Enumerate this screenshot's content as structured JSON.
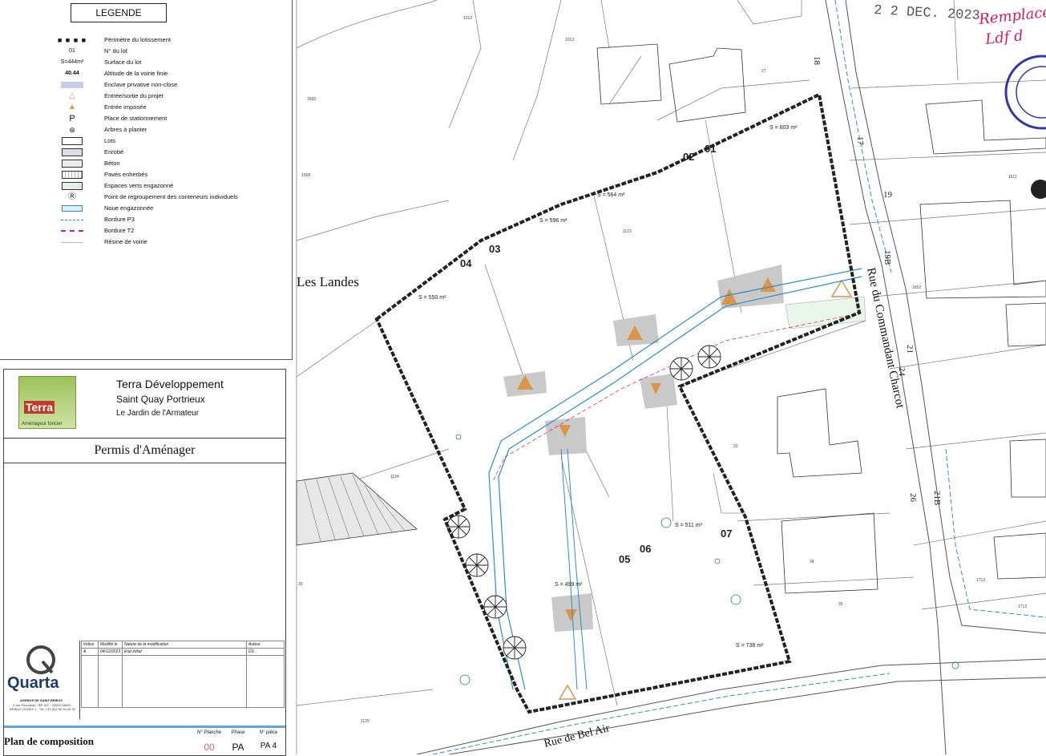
{
  "legend": {
    "title": "LEGENDE",
    "items": [
      {
        "symbol": "■ ■ ■ ■",
        "label": "Périmètre du lotissement"
      },
      {
        "symbol": "01",
        "label": "N° du lot"
      },
      {
        "symbol": "S=444m²",
        "label": "Surface du lot"
      },
      {
        "symbol": "40.44",
        "label": "Altitude de la voirie finie"
      },
      {
        "symbol": "",
        "label": "Enclave privative non-close"
      },
      {
        "symbol": "△",
        "label": "Entrée/sortie du projet"
      },
      {
        "symbol": "▲",
        "label": "Entrée imposée"
      },
      {
        "symbol": "P",
        "label": "Place de stationnement"
      },
      {
        "symbol": "⊛",
        "label": "Arbres à planter"
      },
      {
        "symbol": "",
        "label": "Lots"
      },
      {
        "symbol": "",
        "label": "Enrobé"
      },
      {
        "symbol": "",
        "label": "Béton"
      },
      {
        "symbol": "",
        "label": "Pavés enherbés"
      },
      {
        "symbol": "",
        "label": "Espaces verts engazonné"
      },
      {
        "symbol": "Ⓡ",
        "label": "Point de regroupement des conteneurs individuels"
      },
      {
        "symbol": "",
        "label": "Noue engazonnée"
      },
      {
        "symbol": "",
        "label": "Bordure P3"
      },
      {
        "symbol": "",
        "label": "Bordure T2"
      },
      {
        "symbol": "",
        "label": "Résine de voirie"
      }
    ]
  },
  "cartouche": {
    "logo_word": "Terra",
    "logo_sub": "Aménageur foncier",
    "company": "Terra Développement",
    "city": "Saint Quay Portrieux",
    "project": "Le Jardin de l'Armateur",
    "permit": "Permis d'Aménager",
    "revision_headers": [
      "Indice",
      "Modifié le",
      "Nature de la modification",
      "Auteur"
    ],
    "revision_row": [
      "A",
      "04/12/2023",
      "Etat initial",
      "DS"
    ],
    "quarta_word": "Quarta",
    "quarta_agency": "AGENCE DE SAINT-BRIEUC",
    "quarta_address": "6 rue Puzoneau · BP 327 · 22003 SAINT-BRIEUC CEDEX 1 · Tél. +33 (0)2 96 33 49 32",
    "plan_title": "Plan de composition",
    "sheet_labels": [
      "N° Planche",
      "Phase",
      "N° pièce"
    ],
    "sheet_values": [
      "00",
      "PA",
      "PA 4"
    ]
  },
  "map": {
    "stamp_date": "2 2 DEC. 2023",
    "handwritten": [
      "Remplace",
      "Ldf d"
    ],
    "place_name": "Les Landes",
    "streets": [
      "Rue du Commandant Charcot",
      "Rue de Bel Air"
    ],
    "house_numbers": [
      "18",
      "17",
      "19",
      "19B",
      "21",
      "24",
      "26",
      "21B"
    ],
    "parcels": [
      "1012",
      "1013",
      "1565",
      "1558",
      "1123",
      "1124",
      "1125",
      "1652",
      "1611",
      "1712",
      "1713",
      "33",
      "34",
      "35",
      "27",
      "30"
    ],
    "lots": [
      {
        "num": "01",
        "area": "S = 603 m²"
      },
      {
        "num": "02",
        "area": "S = 564 m²"
      },
      {
        "num": "03",
        "area": "S = 596 m²"
      },
      {
        "num": "04",
        "area": "S = 550 m²"
      },
      {
        "num": "05",
        "area": "S = 499 m²"
      },
      {
        "num": "06",
        "area": "S = 511 m²"
      },
      {
        "num": "07",
        "area": "S = 738 m²"
      }
    ]
  },
  "colors": {
    "perimeter": "#222222",
    "noue": "#2a8fc9",
    "entry": "#d9964a",
    "stamp": "#2d3aa8",
    "handwriting": "#d61a5a"
  }
}
